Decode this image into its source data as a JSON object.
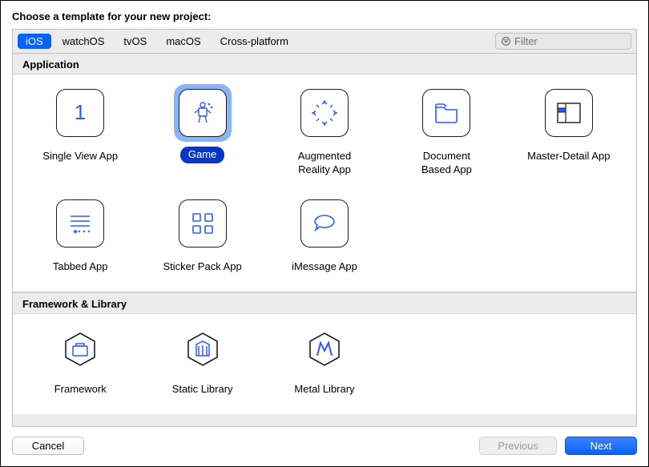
{
  "prompt": "Choose a template for your new project:",
  "platforms": [
    "iOS",
    "watchOS",
    "tvOS",
    "macOS",
    "Cross-platform"
  ],
  "selected_platform": "iOS",
  "filter_placeholder": "Filter",
  "sections": {
    "application": {
      "title": "Application",
      "items": [
        "Single View App",
        "Game",
        "Augmented\nReality App",
        "Document\nBased App",
        "Master-Detail App",
        "Tabbed App",
        "Sticker Pack App",
        "iMessage App"
      ]
    },
    "framework": {
      "title": "Framework & Library",
      "items": [
        "Framework",
        "Static Library",
        "Metal Library"
      ]
    }
  },
  "selected_template": "Game",
  "buttons": {
    "cancel": "Cancel",
    "previous": "Previous",
    "next": "Next"
  },
  "colors": {
    "accent": "#0a60ff",
    "selection_bg": "#8ab4f8",
    "icon_blue": "#2a5cff"
  }
}
